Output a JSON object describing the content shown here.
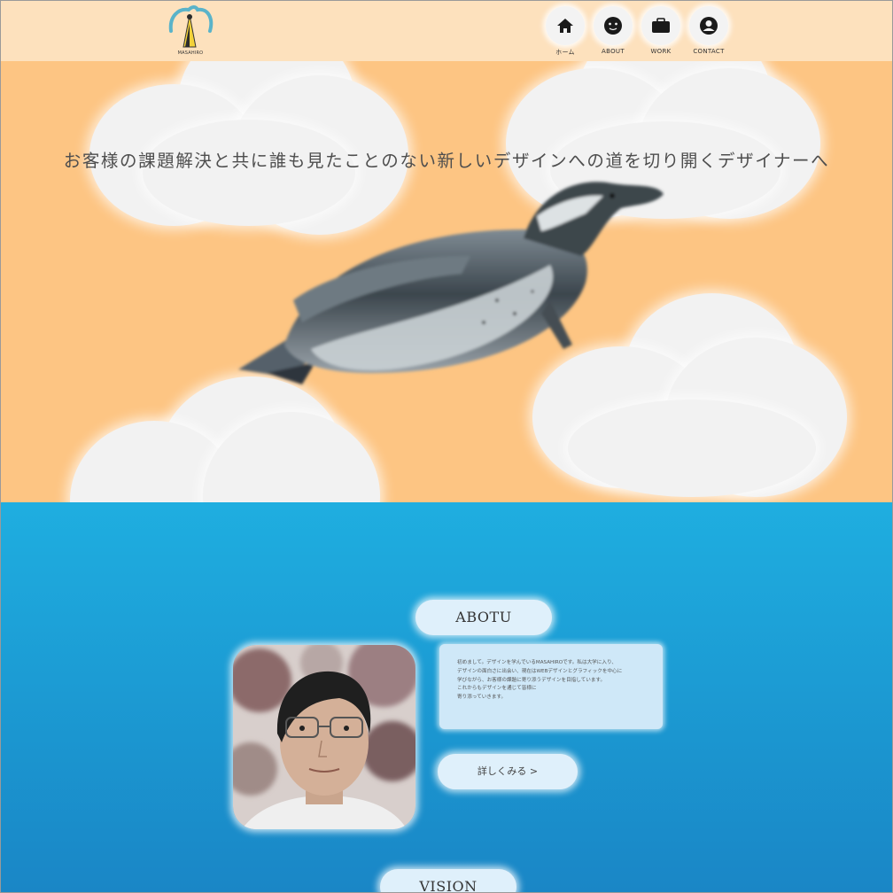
{
  "header": {
    "logo": {
      "icon": "penguin-logo-icon",
      "text": "MASAHIRO"
    },
    "nav": [
      {
        "label": "ホーム",
        "icon": "home-icon"
      },
      {
        "label": "ABOUT",
        "icon": "face-icon"
      },
      {
        "label": "WORK",
        "icon": "briefcase-icon"
      },
      {
        "label": "CONTACT",
        "icon": "user-circle-icon"
      }
    ]
  },
  "hero": {
    "catchcopy": "お客様の課題解決と共に誰も見たことのない新しいデザインへの道を切り開くデザイナーへ",
    "image": "flying-penguin"
  },
  "about": {
    "title": "ABOTU",
    "bio_lines": [
      "初めまして。デザインを学んでいるMASAHIROです。私は大学に入り、",
      "デザインの面白さに出会い、現在はWEBデザインとグラフィックを中心に",
      "学びながら、お客様の課題に寄り添うデザインを目指しています。",
      "これからもデザインを通じて皆様に",
      "寄り添っていきます。"
    ],
    "more_button": "詳しくみる >"
  },
  "vision": {
    "title": "VISION"
  },
  "colors": {
    "header_bg": "#fde1bd",
    "hero_bg": "#fdc583",
    "about_top": "#1faee0",
    "about_bottom": "#1a86c6",
    "pill": "#dff0fb"
  }
}
